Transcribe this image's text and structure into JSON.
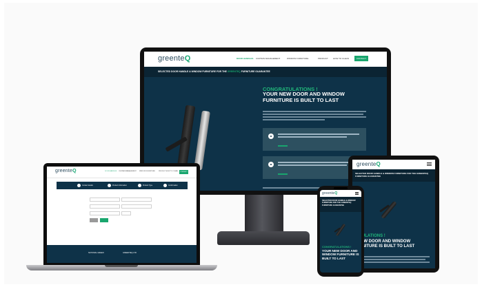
{
  "brand": {
    "logo_main": "greente",
    "logo_accent": "Q",
    "accent_color": "#19a66e",
    "dark_color": "#0e3248"
  },
  "desktop": {
    "nav": {
      "links": [
        "DOOR HANDLES",
        "CURTAIN MANAGEMENT",
        "WINDOW FURNITURE",
        "PRODUCT",
        "HOW TO CLEAN"
      ],
      "cta": "CONTACT"
    },
    "banner": {
      "text_before": "SELECTED DOOR HANDLE & WINDOW FURNITURE FOR THE",
      "text_accent": "GREENTEQ",
      "text_after": "FURNITURE GUARANTEE"
    },
    "hero": {
      "green": "CONGRATULATIONS !",
      "white": "YOUR NEW DOOR AND WINDOW FURNITURE IS BUILT TO LAST"
    },
    "footer_line": "Lorem ipsum dolor sit amet consectetur adipiscing elit sed do eiusmod"
  },
  "laptop": {
    "steps": [
      "Contact details",
      "Product Information",
      "Product Type",
      "Confirmation"
    ],
    "cta": "CONTACT",
    "footer_left": "NATIONAL GREEN",
    "footer_right": "GREENTEQ LTD"
  },
  "tablet": {
    "banner": "SELECTED DOOR HANDLE & WINDOW FURNITURE FOR THE GREENTEQ FURNITURE GUARANTEE",
    "hero_green": "RATULATIONS !",
    "hero_white": "R NEW DOOR AND WINDOW FURNITURE IS BUILT TO LAST"
  },
  "phone": {
    "banner": "SELECTED DOOR HANDLE & WINDOW FURNITURE FOR THE GREENTEQ FURNITURE GUARANTEE",
    "hero_green": "CONGRATULATIONS !",
    "hero_white": "YOUR NEW DOOR AND WINDOW FURNITURE IS BUILT TO LAST"
  }
}
